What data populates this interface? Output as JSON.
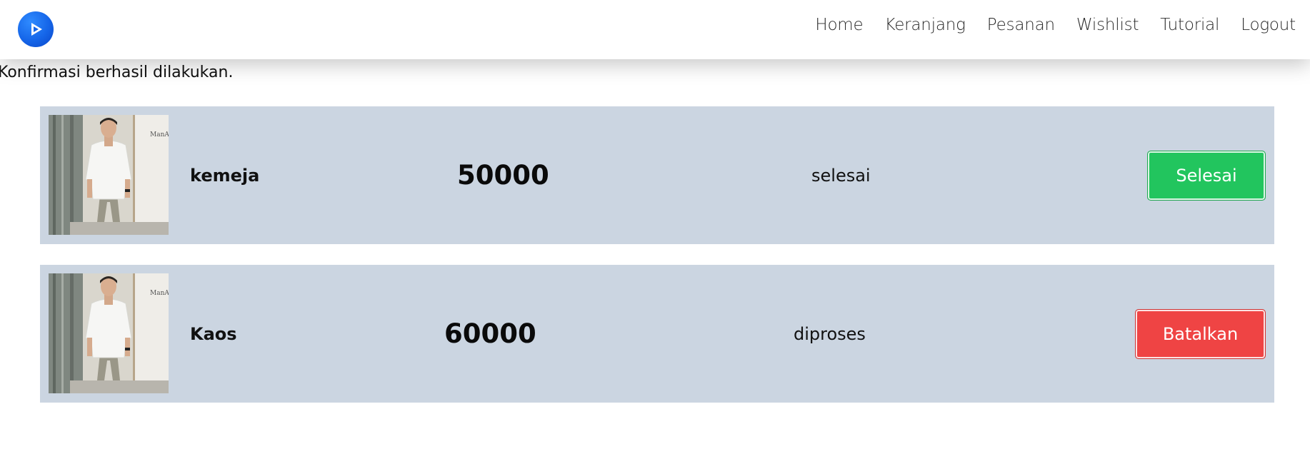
{
  "navbar": {
    "logo_icon": "play-logo-icon",
    "links": [
      "Home",
      "Keranjang",
      "Pesanan",
      "Wishlist",
      "Tutorial",
      "Logout"
    ]
  },
  "flash_message": "Konfirmasi berhasil dilakukan.",
  "orders": [
    {
      "name": "kemeja",
      "price": "50000",
      "status": "selesai",
      "action_label": "Selesai",
      "action_color": "#22c55e",
      "image": "product-shirt-photo"
    },
    {
      "name": "Kaos",
      "price": "60000",
      "status": "diproses",
      "action_label": "Batalkan",
      "action_color": "#ef4444",
      "image": "product-shirt-photo"
    }
  ],
  "colors": {
    "card_background": "#cbd5e1",
    "logo_blue": "#1565e8"
  }
}
